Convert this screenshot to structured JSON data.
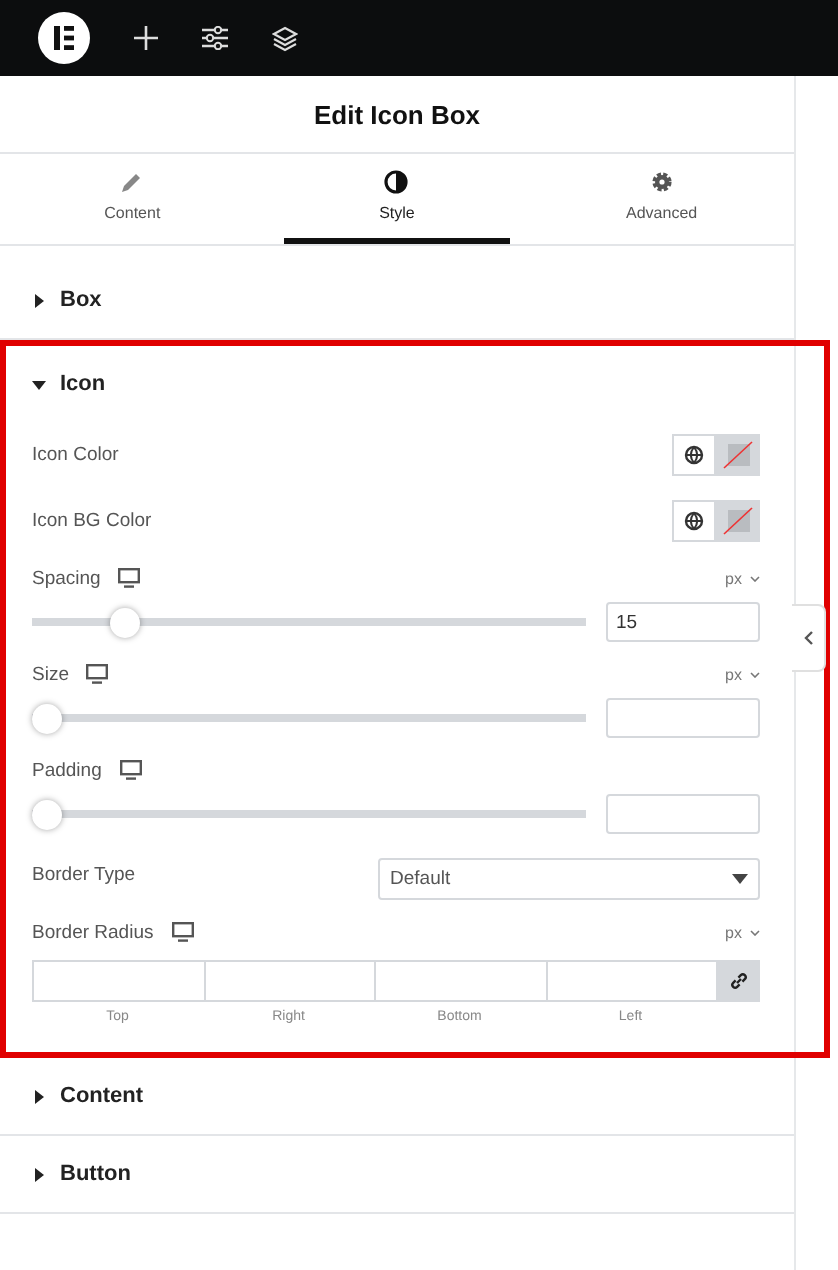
{
  "header": {
    "title": "Edit Icon Box"
  },
  "tabs": [
    {
      "label": "Content",
      "selected": false
    },
    {
      "label": "Style",
      "selected": true
    },
    {
      "label": "Advanced",
      "selected": false
    }
  ],
  "sections": [
    {
      "title": "Box",
      "expanded": false,
      "highlighted": false
    },
    {
      "title": "Icon",
      "expanded": true,
      "highlighted": true,
      "controls": [
        {
          "kind": "color",
          "label": "Icon Color"
        },
        {
          "kind": "color",
          "label": "Icon BG Color"
        },
        {
          "kind": "slider",
          "label": "Spacing",
          "unit": "px",
          "value": "15",
          "level": 0.15
        },
        {
          "kind": "slider",
          "label": "Size",
          "unit": "px",
          "level": 0
        },
        {
          "kind": "slider",
          "label": "Padding",
          "level": 0
        },
        {
          "kind": "select",
          "label": "Border Type",
          "value": "Default"
        },
        {
          "kind": "dimensions",
          "label": "Border Radius",
          "unit": "px",
          "fields": [
            "Top",
            "Right",
            "Bottom",
            "Left"
          ]
        }
      ]
    },
    {
      "title": "Content",
      "expanded": false,
      "highlighted": false
    },
    {
      "title": "Button",
      "expanded": false,
      "highlighted": false
    }
  ]
}
